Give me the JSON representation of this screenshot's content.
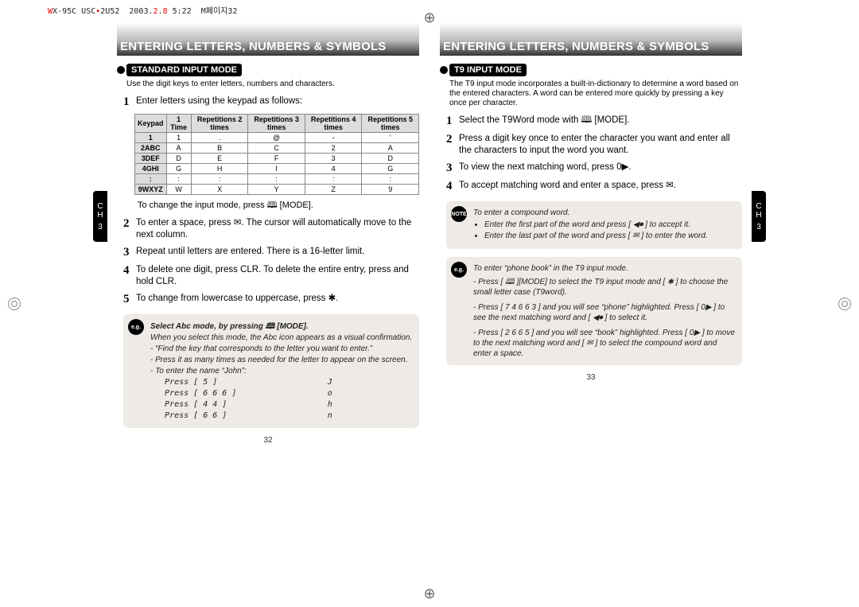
{
  "header": "WX-95C USC 2U52 2003.2.8 5:22 M페이지32",
  "title": "ENTERING LETTERS, NUMBERS & SYMBOLS",
  "left": {
    "section": "STANDARD INPUT MODE",
    "lead": "Use the digit keys to enter letters, numbers and characters.",
    "step1": "Enter letters using the keypad as follows:",
    "table": {
      "head": [
        "Keypad",
        "1 Time",
        "Repetitions 2 times",
        "Repetitions 3 times",
        "Repetitions 4 times",
        "Repetitions 5 times"
      ],
      "rows": [
        [
          "1",
          "1",
          ".",
          "@",
          "-",
          "'"
        ],
        [
          "2ABC",
          "A",
          "B",
          "C",
          "2",
          "A"
        ],
        [
          "3DEF",
          "D",
          "E",
          "F",
          "3",
          "D"
        ],
        [
          "4GHI",
          "G",
          "H",
          "I",
          "4",
          "G"
        ],
        [
          ":",
          ":",
          ":",
          ":",
          ":",
          ":"
        ],
        [
          "9WXYZ",
          "W",
          "X",
          "Y",
          "Z",
          "9"
        ]
      ]
    },
    "sub1": "To change the input mode, press 🕮 [MODE].",
    "step2": "To enter a space, press ✉. The cursor will automatically move to the next column.",
    "step3": "Repeat until letters are entered. There is a 16-letter limit.",
    "step4": "To delete one digit, press CLR. To delete the entire entry, press and hold CLR.",
    "step5": "To change from lowercase to uppercase, press ✱.",
    "note": {
      "badge": "e.g.",
      "title": "Select Abc mode, by pressing 🕮 [MODE].",
      "l1": "When you select this mode, the Abc icon appears as a visual confirmation.",
      "l2": "- “Find the key that corresponds to the letter you want to enter.”",
      "l3": "- Press it as many times as needed for the letter to appear on the screen.",
      "l4": "- To enter the name “John”:",
      "l5": "   Press [ 5 ]                       J",
      "l6": "   Press [ 6 6 6 ]                   o",
      "l7": "   Press [ 4 4 ]                     h",
      "l8": "   Press [ 6 6 ]                     n"
    },
    "page": "32"
  },
  "right": {
    "section": "T9 INPUT MODE",
    "lead": "The T9 input mode incorporates a built-in-dictionary to determine a word based on the entered characters. A word can be entered more quickly by pressing a key once per character.",
    "step1": "Select the T9Word mode with 🕮 [MODE].",
    "step2": "Press a digit key once to enter the character you want and enter all the characters to input the word you want.",
    "step3": "To view the next matching word, press 0▶.",
    "step4": "To accept matching word and enter a space, press ✉.",
    "note1": {
      "badge": "NOTE",
      "title": "To enter a compound word.",
      "b1": "Enter the first part of the word and press [ ◀⏺ ] to accept it.",
      "b2": "Enter the last part of the word and press [ ✉ ] to enter the word."
    },
    "note2": {
      "badge": "e.g.",
      "title": "To enter “phone book” in the T9 input mode.",
      "l1": "- Press [ 🕮 ][MODE] to select the T9 input mode and [ ✱ ] to choose the small letter case (T9word).",
      "l2": "- Press [ 7 4 6 6 3 ] and you will see “phone” highlighted. Press [ 0▶ ] to see the next matching word and [ ◀⏺ ] to select it.",
      "l3": "- Press [ 2 6 6 5 ] and you will see “book” highlighted. Press [ 0▶ ] to move to the next matching word and [ ✉ ] to select the compound word and enter a space."
    },
    "page": "33"
  },
  "tab": {
    "l1": "C",
    "l2": "H",
    "l3": "3"
  }
}
